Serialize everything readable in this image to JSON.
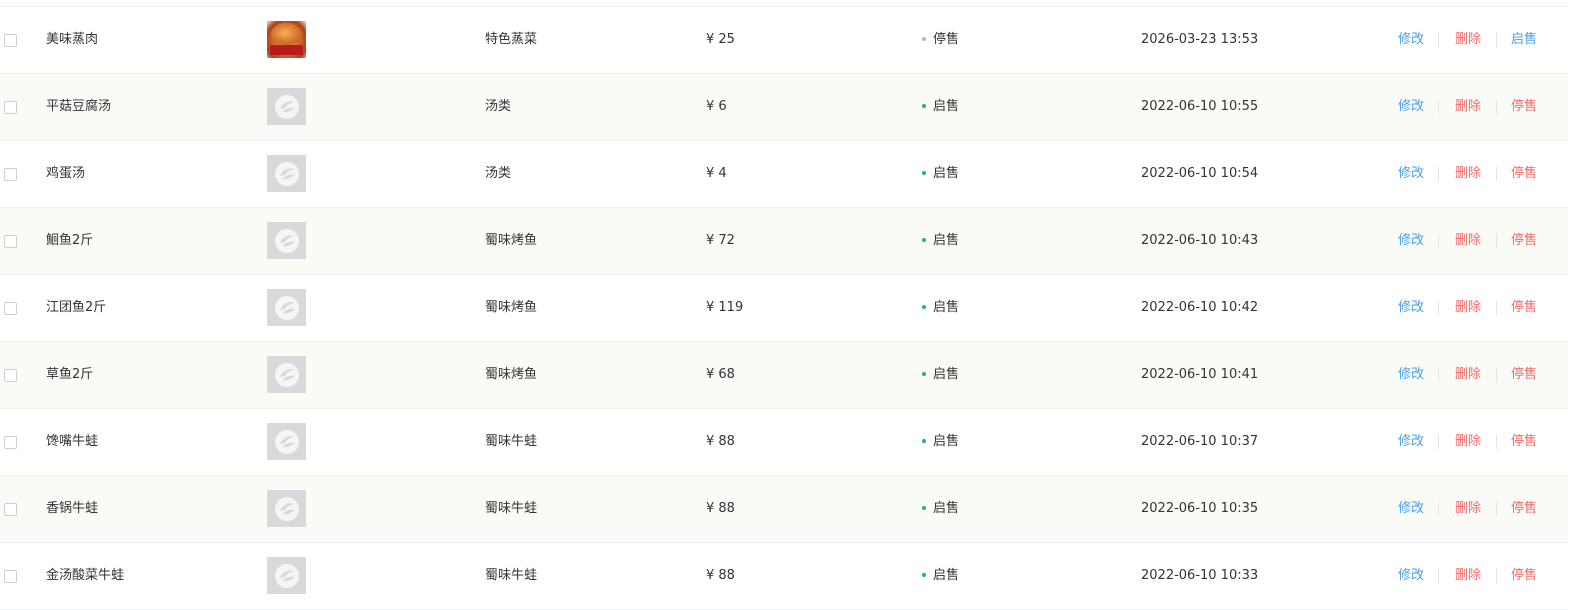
{
  "actions": {
    "edit_label": "修改",
    "delete_label": "删除"
  },
  "colors": {
    "status_on_dot": "#22b573",
    "status_off_dot": "#b8b8b8",
    "link_blue": "#4a9fe8",
    "link_red": "#f06b6b"
  },
  "rows": [
    {
      "name": "美味蒸肉",
      "image": "dish-photo",
      "category": "特色蒸菜",
      "price": "¥ 25",
      "status": "停售",
      "status_on": false,
      "time": "2026-03-23 13:53",
      "toggle_label": "启售"
    },
    {
      "name": "平菇豆腐汤",
      "image": "placeholder-logo-icon",
      "category": "汤类",
      "price": "¥ 6",
      "status": "启售",
      "status_on": true,
      "time": "2022-06-10 10:55",
      "toggle_label": "停售"
    },
    {
      "name": "鸡蛋汤",
      "image": "placeholder-logo-icon",
      "category": "汤类",
      "price": "¥ 4",
      "status": "启售",
      "status_on": true,
      "time": "2022-06-10 10:54",
      "toggle_label": "停售"
    },
    {
      "name": "鮰鱼2斤",
      "image": "placeholder-logo-icon",
      "category": "蜀味烤鱼",
      "price": "¥ 72",
      "status": "启售",
      "status_on": true,
      "time": "2022-06-10 10:43",
      "toggle_label": "停售"
    },
    {
      "name": "江团鱼2斤",
      "image": "placeholder-logo-icon",
      "category": "蜀味烤鱼",
      "price": "¥ 119",
      "status": "启售",
      "status_on": true,
      "time": "2022-06-10 10:42",
      "toggle_label": "停售"
    },
    {
      "name": "草鱼2斤",
      "image": "placeholder-logo-icon",
      "category": "蜀味烤鱼",
      "price": "¥ 68",
      "status": "启售",
      "status_on": true,
      "time": "2022-06-10 10:41",
      "toggle_label": "停售"
    },
    {
      "name": "馋嘴牛蛙",
      "image": "placeholder-logo-icon",
      "category": "蜀味牛蛙",
      "price": "¥ 88",
      "status": "启售",
      "status_on": true,
      "time": "2022-06-10 10:37",
      "toggle_label": "停售"
    },
    {
      "name": "香锅牛蛙",
      "image": "placeholder-logo-icon",
      "category": "蜀味牛蛙",
      "price": "¥ 88",
      "status": "启售",
      "status_on": true,
      "time": "2022-06-10 10:35",
      "toggle_label": "停售"
    },
    {
      "name": "金汤酸菜牛蛙",
      "image": "placeholder-logo-icon",
      "category": "蜀味牛蛙",
      "price": "¥ 88",
      "status": "启售",
      "status_on": true,
      "time": "2022-06-10 10:33",
      "toggle_label": "停售"
    }
  ]
}
